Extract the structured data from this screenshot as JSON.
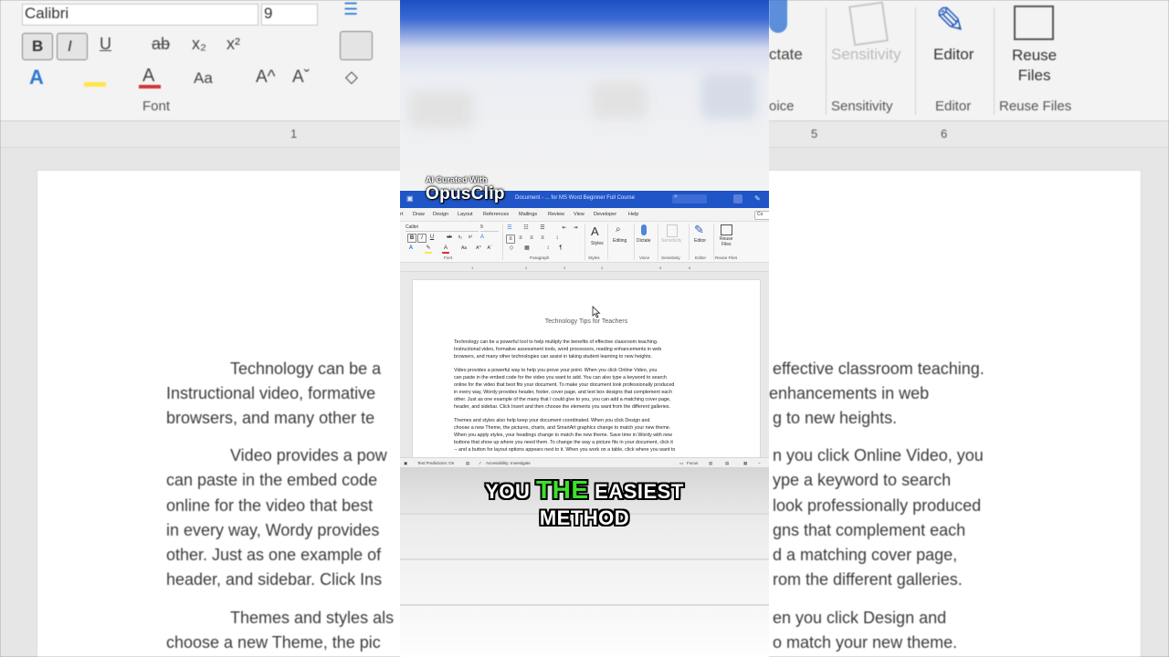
{
  "background": {
    "font_box": "Calibri",
    "size_box": "9",
    "font_group": "Font",
    "right_buttons": [
      {
        "label": "ctate",
        "group": "oice"
      },
      {
        "label": "Sensitivity",
        "group": "Sensitivity"
      },
      {
        "label": "Editor",
        "group": "Editor"
      },
      {
        "label": "Reuse\nFiles",
        "group": "Reuse Files"
      }
    ],
    "ruler_numbers": [
      "1",
      "5",
      "6"
    ],
    "left_lines": [
      "Technology can be a",
      "Instructional video, formative",
      "browsers, and many other te",
      "Video provides a pow",
      "can paste in the embed code",
      "online for the video that best",
      "in every way, Wordy provides",
      "other. Just as one example of",
      "header, and sidebar. Click Ins",
      "Themes and styles als",
      "choose a new Theme, the pic"
    ],
    "right_lines": [
      "effective classroom teaching.",
      "enhancements in web",
      "g to new heights.",
      "n you click Online Video, you",
      "ype a keyword to search",
      "look professionally produced",
      "gns that complement each",
      "d a matching cover page,",
      "rom the different galleries.",
      "en you click Design and",
      "o match your new theme."
    ]
  },
  "word": {
    "title": "Document - ... for MS Word Beginner Full Course",
    "menu_tabs": [
      "rt",
      "Draw",
      "Design",
      "Layout",
      "References",
      "Mailings",
      "Review",
      "View",
      "Developer",
      "Help"
    ],
    "comments_label": "Co",
    "font_name": "Calibri",
    "font_size": "9",
    "groups": {
      "font": "Font",
      "paragraph": "Paragraph",
      "styles": "Styles",
      "voice": "Voice",
      "sensitivity": "Sensitivity",
      "editor": "Editor",
      "reuse": "Reuse Files"
    },
    "buttons": {
      "styles": "Styles",
      "editing": "Editing",
      "dictate": "Dictate",
      "sensitivity": "Sensitivity",
      "editor": "Editor",
      "reuse": "Reuse\nFiles"
    },
    "ruler_numbers": [
      "1",
      "2",
      "3",
      "4",
      "5",
      "6"
    ],
    "doc_title": "Technology Tips for Teachers",
    "paragraphs": [
      [
        "           Technology can be a powerful tool to help multiply the benefits of effective classroom teaching.",
        "Instructional video, formative assessment tools, word processors, reading enhancements in web",
        "browsers, and many other technologies can assist in taking student learning to new heights."
      ],
      [
        "           Video provides a powerful way to help you prove your point. When you click Online Video, you",
        "can paste in the embed code for the video you want to add. You can also type a keyword to search",
        "online for the video that best fits your document. To make your document look professionally produced",
        "in every way, Wordy provides header, footer, cover page, and text box designs that complement each",
        "other. Just as one example of the many that I could give to you, you can add a matching cover page,",
        "header, and sidebar. Click Insert and then choose the elements you want from the different galleries."
      ],
      [
        "           Themes and styles also help keep your document coordinated. When you click Design and",
        "choose a new Theme, the pictures, charts, and SmartArt graphics change to match your new theme.",
        "When you apply styles, your headings change to match the new theme. Save time in Wordy with new",
        "buttons that show up where you need them.  To change the way a picture fits in your document, click it",
        "-- and a button for layout options appears next to it. When you work on a table, click where you want to"
      ]
    ],
    "status": {
      "predictions": "Text Predictions: On",
      "accessibility": "Accessibility: Investigate",
      "focus": "Focus"
    }
  },
  "overlay": {
    "watermark_small": "AI Curated With",
    "watermark_big": "OpusClip",
    "caption_line1_a": "YOU",
    "caption_line1_hl": "THE",
    "caption_line1_b": "EASIEST",
    "caption_line2": "METHOD",
    "highlight_color": "#3be12a"
  },
  "colors": {
    "titlebar": "#1f55c6",
    "accent": "#2b579a"
  }
}
